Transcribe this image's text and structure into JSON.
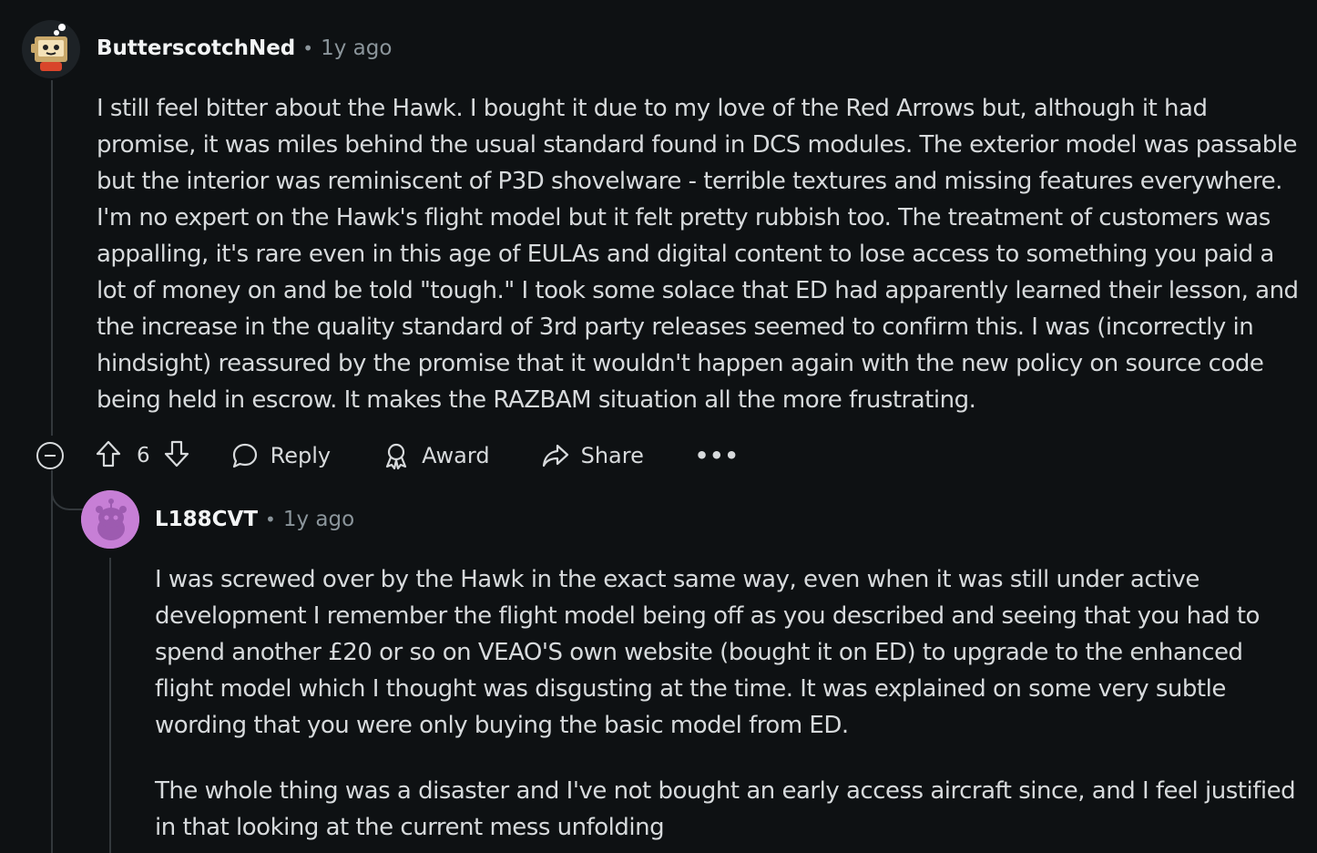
{
  "comment": {
    "author": "ButterscotchNed",
    "separator": "•",
    "time": "1y ago",
    "paragraphs": [
      "I still feel bitter about the Hawk. I bought it due to my love of the Red Arrows but, although it had promise, it was miles behind the usual standard found in DCS modules. The exterior model was passable but the interior was reminiscent of P3D shovelware - terrible textures and missing features everywhere. I'm no expert on the Hawk's flight model but it felt pretty rubbish too. The treatment of customers was appalling, it's rare even in this age of EULAs and digital content to lose access to something you paid a lot of money on and be told \"tough.\" I took some solace that ED had apparently learned their lesson, and the increase in the quality standard of 3rd party releases seemed to confirm this. I was (incorrectly in hindsight) reassured by the promise that it wouldn't happen again with the new policy on source code being held in escrow. It makes the RAZBAM situation all the more frustrating."
    ],
    "votes": "6",
    "actions": {
      "reply": "Reply",
      "award": "Award",
      "share": "Share",
      "more": "•••"
    }
  },
  "reply": {
    "author": "L188CVT",
    "separator": "•",
    "time": "1y ago",
    "paragraphs": [
      "I was screwed over by the Hawk in the exact same way, even when it was still under active development I remember the flight model being off as you described and seeing that you had to spend another £20 or so on VEAO'S own website (bought it on ED) to upgrade to the enhanced flight model which I thought was disgusting at the time. It was explained on some very subtle wording that you were only buying the basic model from ED.",
      "The whole thing was a disaster and I've not bought an early access aircraft since, and I feel justified in that looking at the current mess unfolding"
    ]
  },
  "icons": [
    "collapse-icon",
    "upvote-icon",
    "downvote-icon",
    "comment-icon",
    "award-icon",
    "share-icon",
    "more-icon"
  ],
  "colors": {
    "background": "#0e1113",
    "text": "#d7dadc",
    "muted": "#8b959b",
    "reply_avatar": "#c77fd6"
  }
}
